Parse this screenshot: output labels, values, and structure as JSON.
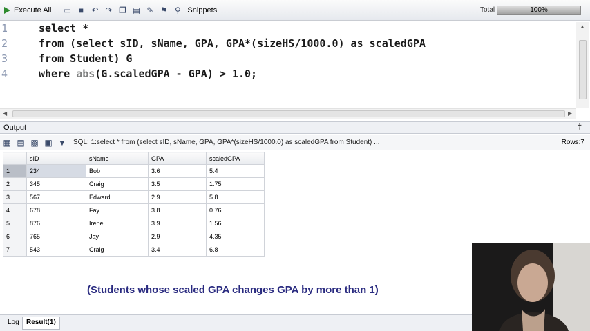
{
  "toolbar": {
    "execute_label": "Execute All",
    "snippets_label": "Snippets",
    "total_label": "Total",
    "progress_text": "100%",
    "progress": 1.0
  },
  "editor": {
    "line_numbers": [
      "1",
      "2",
      "3",
      "4"
    ],
    "lines": [
      "select *",
      "from (select sID, sName, GPA, GPA*(sizeHS/1000.0) as scaledGPA",
      "from Student) G",
      "where abs(G.scaledGPA - GPA) > 1.0;"
    ],
    "line4_pre": "where ",
    "line4_fn": "abs",
    "line4_post": "(G.scaledGPA - GPA) > 1.0;"
  },
  "output": {
    "title": "Output",
    "pin_glyph": "‡",
    "sql_text": "SQL: 1:select *  from (select sID, sName, GPA, GPA*(sizeHS/1000.0) as scaledGPA  from Student) ...",
    "rows_label": "Rows:7"
  },
  "grid": {
    "columns": [
      "sID",
      "sName",
      "GPA",
      "scaledGPA"
    ],
    "rows": [
      {
        "n": "1",
        "sID": "234",
        "sName": "Bob",
        "GPA": "3.6",
        "scaledGPA": "5.4"
      },
      {
        "n": "2",
        "sID": "345",
        "sName": "Craig",
        "GPA": "3.5",
        "scaledGPA": "1.75"
      },
      {
        "n": "3",
        "sID": "567",
        "sName": "Edward",
        "GPA": "2.9",
        "scaledGPA": "5.8"
      },
      {
        "n": "4",
        "sID": "678",
        "sName": "Fay",
        "GPA": "3.8",
        "scaledGPA": "0.76"
      },
      {
        "n": "5",
        "sID": "876",
        "sName": "Irene",
        "GPA": "3.9",
        "scaledGPA": "1.56"
      },
      {
        "n": "6",
        "sID": "765",
        "sName": "Jay",
        "GPA": "2.9",
        "scaledGPA": "4.35"
      },
      {
        "n": "7",
        "sID": "543",
        "sName": "Craig",
        "GPA": "3.4",
        "scaledGPA": "6.8"
      }
    ]
  },
  "caption": "(Students whose scaled GPA changes GPA by more than 1)",
  "tabs": [
    "Log",
    "Result(1)"
  ],
  "colors": {
    "caption": "#2a2b80",
    "line_numbers": "#8d99b2",
    "function": "#7f8080"
  }
}
